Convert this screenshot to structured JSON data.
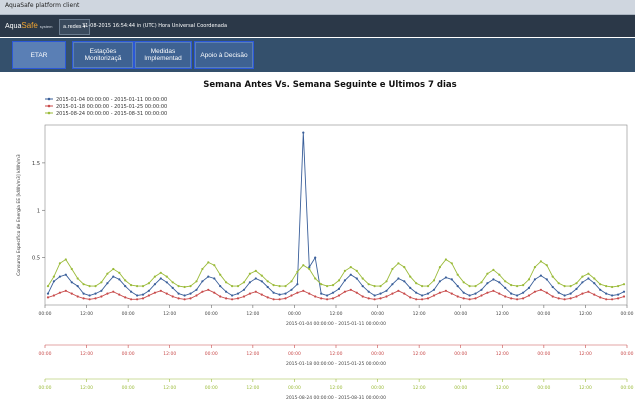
{
  "window": {
    "title": "AquaSafe platform client"
  },
  "header": {
    "brand_aqua": "Aqua",
    "brand_safe": "Safe",
    "brand_system": "system",
    "user": "a.redes ▾",
    "datetime": "31-08-2015 16:54:44 in (UTC) Hora Universal Coordenada"
  },
  "menu": [
    {
      "label": "ETAR"
    },
    {
      "label": "Estações Monitorizaçã"
    },
    {
      "label": "Medidas Implementad"
    },
    {
      "label": "Apoio à Decisão"
    }
  ],
  "chart_data": {
    "type": "line",
    "title": "Semana Antes Vs. Semana Seguinte e Ultimos 7 dias",
    "ylabel": "Consumo Específico de Energia EE [kWh/m3] kWh/m3",
    "ylim": [
      0,
      1.9
    ],
    "yticks": [
      "0.5",
      "1",
      "1.5"
    ],
    "xtick_labels": [
      "00:00",
      "12:00",
      "00:00",
      "12:00",
      "00:00",
      "12:00",
      "00:00",
      "12:00",
      "00:00",
      "12:00",
      "00:00",
      "12:00",
      "00:00",
      "12:00",
      "00:00"
    ],
    "series": [
      {
        "name": "2015-01-04 00:00:00 - 2015-01-11 00:00:00",
        "color": "#3a5f9a",
        "axis_label": "2015-01-04 00:00:00 - 2015-01-11 00:00:00",
        "values": [
          0.12,
          0.25,
          0.3,
          0.32,
          0.24,
          0.2,
          0.12,
          0.1,
          0.12,
          0.15,
          0.23,
          0.3,
          0.27,
          0.2,
          0.14,
          0.1,
          0.11,
          0.15,
          0.22,
          0.28,
          0.24,
          0.18,
          0.12,
          0.1,
          0.12,
          0.16,
          0.25,
          0.3,
          0.28,
          0.2,
          0.14,
          0.1,
          0.12,
          0.16,
          0.24,
          0.28,
          0.25,
          0.19,
          0.13,
          0.11,
          0.12,
          0.16,
          0.22,
          1.82,
          0.4,
          0.5,
          0.12,
          0.1,
          0.13,
          0.17,
          0.26,
          0.32,
          0.28,
          0.2,
          0.14,
          0.1,
          0.12,
          0.15,
          0.22,
          0.28,
          0.25,
          0.18,
          0.13,
          0.1,
          0.12,
          0.16,
          0.25,
          0.29,
          0.27,
          0.2,
          0.13,
          0.1,
          0.12,
          0.16,
          0.23,
          0.27,
          0.24,
          0.18,
          0.12,
          0.1,
          0.13,
          0.18,
          0.27,
          0.31,
          0.27,
          0.19,
          0.13,
          0.1,
          0.12,
          0.17,
          0.24,
          0.28,
          0.23,
          0.16,
          0.12,
          0.1,
          0.11,
          0.14
        ]
      },
      {
        "name": "2015-01-18 00:00:00 - 2015-01-25 00:00:00",
        "color": "#c84a4a",
        "axis_label": "2015-01-18 00:00:00 - 2015-01-25 00:00:00",
        "values": [
          0.08,
          0.1,
          0.13,
          0.15,
          0.12,
          0.09,
          0.07,
          0.06,
          0.07,
          0.09,
          0.12,
          0.14,
          0.11,
          0.08,
          0.06,
          0.06,
          0.07,
          0.1,
          0.13,
          0.15,
          0.12,
          0.09,
          0.07,
          0.06,
          0.07,
          0.1,
          0.14,
          0.16,
          0.13,
          0.09,
          0.07,
          0.06,
          0.07,
          0.09,
          0.12,
          0.14,
          0.11,
          0.08,
          0.06,
          0.06,
          0.07,
          0.1,
          0.13,
          0.15,
          0.12,
          0.09,
          0.07,
          0.06,
          0.07,
          0.1,
          0.14,
          0.16,
          0.13,
          0.09,
          0.07,
          0.06,
          0.07,
          0.09,
          0.12,
          0.15,
          0.12,
          0.08,
          0.06,
          0.06,
          0.07,
          0.1,
          0.13,
          0.15,
          0.12,
          0.09,
          0.07,
          0.06,
          0.07,
          0.1,
          0.13,
          0.15,
          0.12,
          0.09,
          0.07,
          0.06,
          0.07,
          0.1,
          0.14,
          0.16,
          0.13,
          0.09,
          0.07,
          0.06,
          0.07,
          0.09,
          0.12,
          0.14,
          0.11,
          0.08,
          0.06,
          0.06,
          0.07,
          0.09
        ]
      },
      {
        "name": "2015-08-24 00:00:00 - 2015-08-31 00:00:00",
        "color": "#9bbb3a",
        "axis_label": "2015-08-24 00:00:00 - 2015-08-31 00:00:00",
        "values": [
          0.2,
          0.3,
          0.44,
          0.48,
          0.38,
          0.28,
          0.22,
          0.2,
          0.2,
          0.24,
          0.33,
          0.38,
          0.34,
          0.26,
          0.21,
          0.2,
          0.2,
          0.23,
          0.3,
          0.34,
          0.3,
          0.24,
          0.2,
          0.19,
          0.2,
          0.25,
          0.38,
          0.45,
          0.42,
          0.32,
          0.24,
          0.2,
          0.2,
          0.24,
          0.33,
          0.36,
          0.31,
          0.25,
          0.21,
          0.2,
          0.2,
          0.25,
          0.35,
          0.42,
          0.38,
          0.28,
          0.22,
          0.2,
          0.21,
          0.26,
          0.36,
          0.4,
          0.36,
          0.28,
          0.22,
          0.2,
          0.2,
          0.25,
          0.38,
          0.44,
          0.4,
          0.3,
          0.23,
          0.2,
          0.2,
          0.26,
          0.4,
          0.48,
          0.44,
          0.32,
          0.24,
          0.2,
          0.2,
          0.24,
          0.33,
          0.37,
          0.32,
          0.25,
          0.21,
          0.2,
          0.21,
          0.27,
          0.4,
          0.46,
          0.42,
          0.3,
          0.23,
          0.2,
          0.2,
          0.23,
          0.3,
          0.33,
          0.28,
          0.22,
          0.2,
          0.19,
          0.2,
          0.22
        ]
      }
    ]
  }
}
